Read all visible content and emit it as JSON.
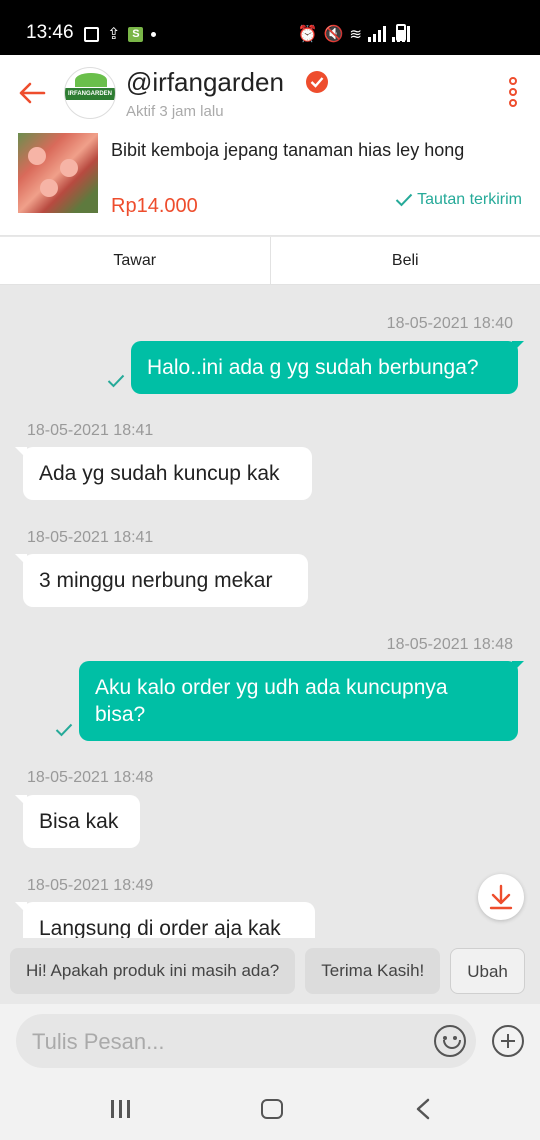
{
  "status_bar": {
    "time": "13:46"
  },
  "header": {
    "username": "@irfangarden",
    "activity": "Aktif 3 jam lalu",
    "avatar_text": "IRFANGARDEN"
  },
  "product": {
    "title": "Bibit kemboja jepang tanaman hias ley hong",
    "price": "Rp14.000",
    "sent_label": "Tautan terkirim"
  },
  "actions": {
    "offer": "Tawar",
    "buy": "Beli"
  },
  "messages": [
    {
      "time": "18-05-2021 18:40",
      "text": "Halo..ini ada g yg sudah berbunga?",
      "direction": "out"
    },
    {
      "time": "18-05-2021 18:41",
      "text": "Ada yg sudah kuncup kak",
      "direction": "in"
    },
    {
      "time": "18-05-2021 18:41",
      "text": "3 minggu nerbung mekar",
      "direction": "in"
    },
    {
      "time": "18-05-2021 18:48",
      "text": "Aku kalo order yg udh ada kuncupnya bisa?",
      "direction": "out"
    },
    {
      "time": "18-05-2021 18:48",
      "text": "Bisa kak",
      "direction": "in"
    },
    {
      "time": "18-05-2021 18:49",
      "text": "Langsung di order aja kak",
      "direction": "in"
    }
  ],
  "quick_replies": [
    "Hi! Apakah produk ini masih ada?",
    "Terima Kasih!",
    "Ubah"
  ],
  "input": {
    "placeholder": "Tulis Pesan..."
  },
  "colors": {
    "accent": "#ee4d2d",
    "outgoing_bubble": "#00bfa5",
    "sent_tick": "#26aa99"
  }
}
